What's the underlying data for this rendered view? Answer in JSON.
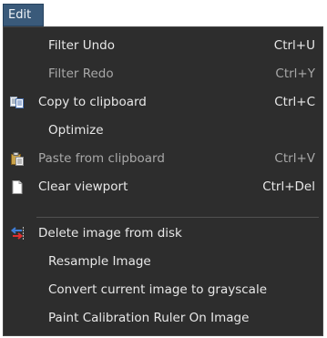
{
  "menubar": {
    "edit_label": "Edit"
  },
  "menu": {
    "items": [
      {
        "label": "Filter Undo",
        "shortcut": "Ctrl+U",
        "icon": "",
        "enabled": true
      },
      {
        "label": "Filter Redo",
        "shortcut": "Ctrl+Y",
        "icon": "",
        "enabled": false
      },
      {
        "label": "Copy to clipboard",
        "shortcut": "Ctrl+C",
        "icon": "copy-icon",
        "enabled": true
      },
      {
        "label": "Optimize",
        "shortcut": "",
        "icon": "",
        "enabled": true
      },
      {
        "label": "Paste from clipboard",
        "shortcut": "Ctrl+V",
        "icon": "paste-icon",
        "enabled": false
      },
      {
        "label": "Clear viewport",
        "shortcut": "Ctrl+Del",
        "icon": "document-icon",
        "enabled": true
      },
      {
        "label": "Delete image from disk",
        "shortcut": "",
        "icon": "delete-arrows-icon",
        "enabled": true
      },
      {
        "label": "Resample Image",
        "shortcut": "",
        "icon": "",
        "enabled": true
      },
      {
        "label": "Convert current image to grayscale",
        "shortcut": "",
        "icon": "",
        "enabled": true
      },
      {
        "label": "Paint Calibration Ruler On Image",
        "shortcut": "",
        "icon": "",
        "enabled": true
      }
    ]
  },
  "colors": {
    "menu_background": "#2d2d2d",
    "menubar_highlight": "#3a5a7a",
    "text_enabled": "#e8e8e8",
    "text_disabled": "#a8a8a8"
  }
}
